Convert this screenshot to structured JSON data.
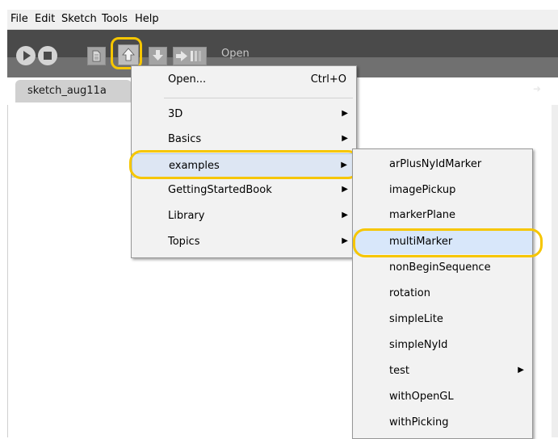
{
  "menubar": {
    "items": [
      "File",
      "Edit",
      "Sketch",
      "Tools",
      "Help"
    ]
  },
  "toolbar": {
    "status_label": "Open"
  },
  "tab": {
    "label": "sketch_aug11a"
  },
  "open_menu": {
    "open_label": "Open...",
    "open_shortcut": "Ctrl+O",
    "items": [
      "3D",
      "Basics",
      "examples",
      "GettingStartedBook",
      "Library",
      "Topics"
    ]
  },
  "examples_submenu": {
    "items": [
      "arPlusNyIdMarker",
      "imagePickup",
      "markerPlane",
      "multiMarker",
      "nonBeginSequence",
      "rotation",
      "simpleLite",
      "simpleNyId",
      "test",
      "withOpenGL",
      "withPicking"
    ]
  },
  "colors": {
    "highlight_ring": "#f6c600",
    "toolbar_bg": "#4a4a4a",
    "menu_hover": "#d8e7fa"
  }
}
